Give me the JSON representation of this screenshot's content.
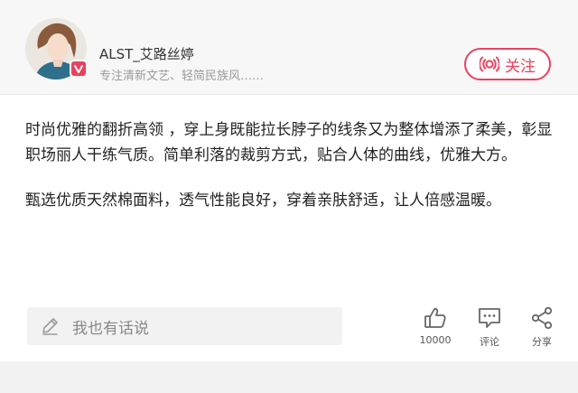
{
  "author": {
    "name": "ALST_艾路丝婷",
    "description": "专注清新文艺、轻简民族风……",
    "verified_badge_icon": "v-badge-icon",
    "avatar_icon": "avatar"
  },
  "follow": {
    "label": "关注",
    "icon": "broadcast-icon",
    "accent_color": "#e8425f"
  },
  "content": {
    "paragraphs": [
      "时尚优雅的翻折高领 ，穿上身既能拉长脖子的线条又为整体增添了柔美，彰显职场丽人干练气质。简单利落的裁剪方式，贴合人体的曲线，优雅大方。",
      "甄选优质天然棉面料，透气性能良好，穿着亲肤舒适，让人倍感温暖。"
    ]
  },
  "comment": {
    "placeholder": "我也有话说",
    "icon": "pencil-icon"
  },
  "actions": {
    "like": {
      "label": "10000",
      "icon": "thumbs-up-icon"
    },
    "comment": {
      "label": "评论",
      "icon": "comment-icon"
    },
    "share": {
      "label": "分享",
      "icon": "share-icon"
    }
  }
}
